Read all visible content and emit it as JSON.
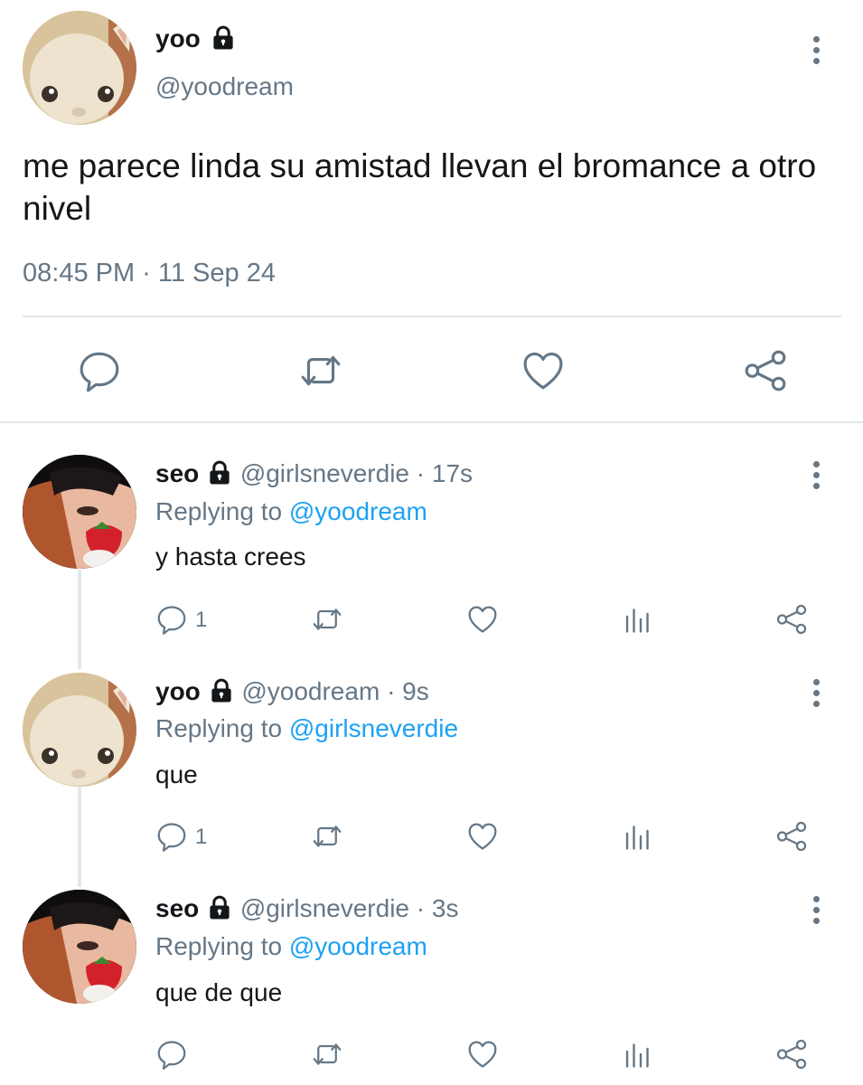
{
  "main_tweet": {
    "name": "yoo",
    "handle": "@yoodream",
    "text": "me parece linda su amistad llevan el bromance a otro nivel",
    "timestamp": "08:45 PM · 11 Sep 24"
  },
  "replies": [
    {
      "name": "seo",
      "handle": "@girlsneverdie",
      "time": "· 17s",
      "replying_prefix": "Replying to",
      "replying_to": "@yoodream",
      "text": "y hasta crees",
      "reply_count": "1"
    },
    {
      "name": "yoo",
      "handle": "@yoodream",
      "time": "· 9s",
      "replying_prefix": "Replying to",
      "replying_to": "@girlsneverdie",
      "text": "que",
      "reply_count": "1"
    },
    {
      "name": "seo",
      "handle": "@girlsneverdie",
      "time": "· 3s",
      "replying_prefix": "Replying to",
      "replying_to": "@yoodream",
      "text": "que de que",
      "reply_count": ""
    }
  ],
  "colors": {
    "text": "#14171a",
    "muted": "#657786",
    "link": "#1da1f2",
    "divider": "#e1e8ed"
  },
  "icons": [
    "lock-icon",
    "more-options-icon",
    "reply-icon",
    "retweet-icon",
    "like-icon",
    "share-icon",
    "analytics-icon"
  ]
}
